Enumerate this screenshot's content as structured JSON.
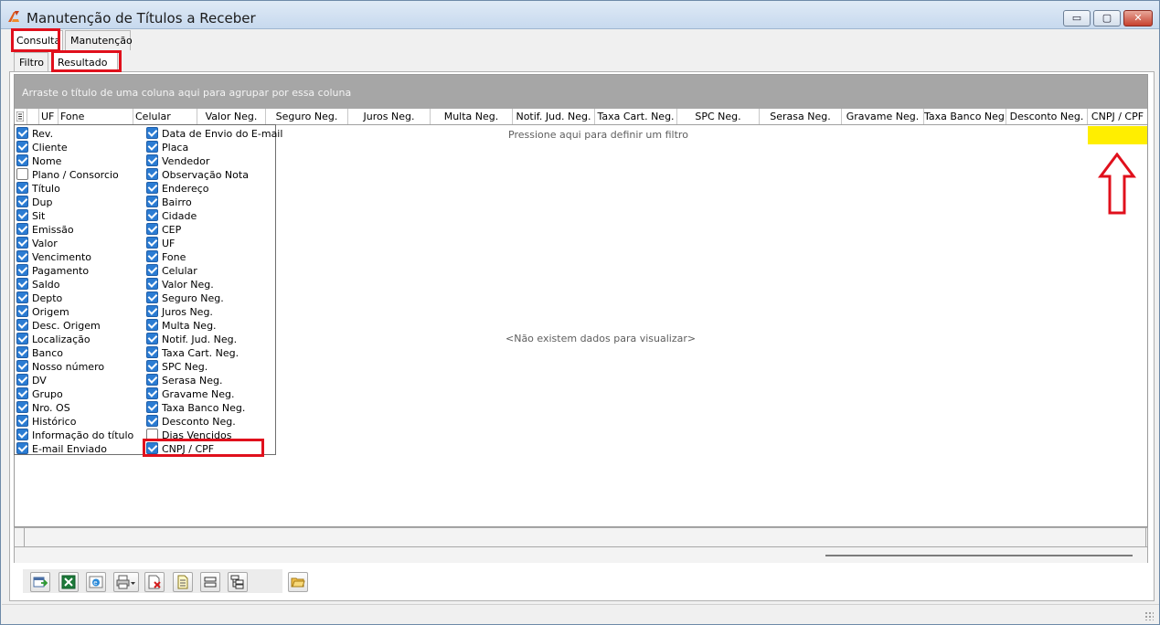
{
  "window": {
    "title": "Manutenção de Títulos a Receber",
    "controls": {
      "minimize": "▭",
      "maximize": "▢",
      "close": "✕"
    }
  },
  "tabs_main": [
    "Consulta",
    "Manutenção"
  ],
  "tabs_sub": [
    "Filtro",
    "Resultado"
  ],
  "grid": {
    "group_prompt": "Arraste o título de uma coluna aqui para agrupar por essa coluna",
    "columns": [
      "UF",
      "Fone",
      "Celular",
      "Valor Neg.",
      "Seguro Neg.",
      "Juros Neg.",
      "Multa Neg.",
      "Notif. Jud. Neg.",
      "Taxa Cart. Neg.",
      "SPC Neg.",
      "Serasa Neg.",
      "Gravame Neg.",
      "Taxa Banco Neg.",
      "Desconto Neg.",
      "CNPJ / CPF"
    ],
    "filter_prompt": "Pressione aqui para definir um filtro",
    "empty_message": "<Não existem dados para visualizar>"
  },
  "column_chooser": {
    "left": [
      {
        "label": "Rev.",
        "checked": true
      },
      {
        "label": "Cliente",
        "checked": true
      },
      {
        "label": "Nome",
        "checked": true
      },
      {
        "label": "Plano / Consorcio",
        "checked": false
      },
      {
        "label": "Título",
        "checked": true
      },
      {
        "label": "Dup",
        "checked": true
      },
      {
        "label": "Sit",
        "checked": true
      },
      {
        "label": "Emissão",
        "checked": true
      },
      {
        "label": "Valor",
        "checked": true
      },
      {
        "label": "Vencimento",
        "checked": true
      },
      {
        "label": "Pagamento",
        "checked": true
      },
      {
        "label": "Saldo",
        "checked": true
      },
      {
        "label": "Depto",
        "checked": true
      },
      {
        "label": "Origem",
        "checked": true
      },
      {
        "label": "Desc. Origem",
        "checked": true
      },
      {
        "label": "Localização",
        "checked": true
      },
      {
        "label": "Banco",
        "checked": true
      },
      {
        "label": "Nosso número",
        "checked": true
      },
      {
        "label": "DV",
        "checked": true
      },
      {
        "label": "Grupo",
        "checked": true
      },
      {
        "label": "Nro. OS",
        "checked": true
      },
      {
        "label": "Histórico",
        "checked": true
      },
      {
        "label": "Informação do título",
        "checked": true
      },
      {
        "label": "E-mail Enviado",
        "checked": true
      }
    ],
    "right": [
      {
        "label": "Data de Envio do E-mail",
        "checked": true
      },
      {
        "label": "Placa",
        "checked": true
      },
      {
        "label": "Vendedor",
        "checked": true
      },
      {
        "label": "Observação Nota",
        "checked": true
      },
      {
        "label": "Endereço",
        "checked": true
      },
      {
        "label": "Bairro",
        "checked": true
      },
      {
        "label": "Cidade",
        "checked": true
      },
      {
        "label": "CEP",
        "checked": true
      },
      {
        "label": "UF",
        "checked": true
      },
      {
        "label": "Fone",
        "checked": true
      },
      {
        "label": "Celular",
        "checked": true
      },
      {
        "label": "Valor Neg.",
        "checked": true
      },
      {
        "label": "Seguro Neg.",
        "checked": true
      },
      {
        "label": "Juros Neg.",
        "checked": true
      },
      {
        "label": "Multa Neg.",
        "checked": true
      },
      {
        "label": "Notif. Jud. Neg.",
        "checked": true
      },
      {
        "label": "Taxa Cart. Neg.",
        "checked": true
      },
      {
        "label": "SPC Neg.",
        "checked": true
      },
      {
        "label": "Serasa Neg.",
        "checked": true
      },
      {
        "label": "Gravame Neg.",
        "checked": true
      },
      {
        "label": "Taxa Banco Neg.",
        "checked": true
      },
      {
        "label": "Desconto Neg.",
        "checked": true
      },
      {
        "label": "Dias Vencidos",
        "checked": false
      },
      {
        "label": "CNPJ / CPF",
        "checked": true
      }
    ]
  },
  "toolbar": {
    "buttons": [
      "export-icon",
      "excel-icon",
      "browser-icon",
      "print-icon",
      "delete-doc-icon",
      "document-icon",
      "collapse-icon",
      "tree-icon",
      "folder-icon"
    ]
  },
  "colors": {
    "highlight_red": "#e0101c",
    "highlight_yellow": "#ffee00",
    "checkbox_blue": "#2b7cd3",
    "group_bar_gray": "#a6a6a6"
  }
}
